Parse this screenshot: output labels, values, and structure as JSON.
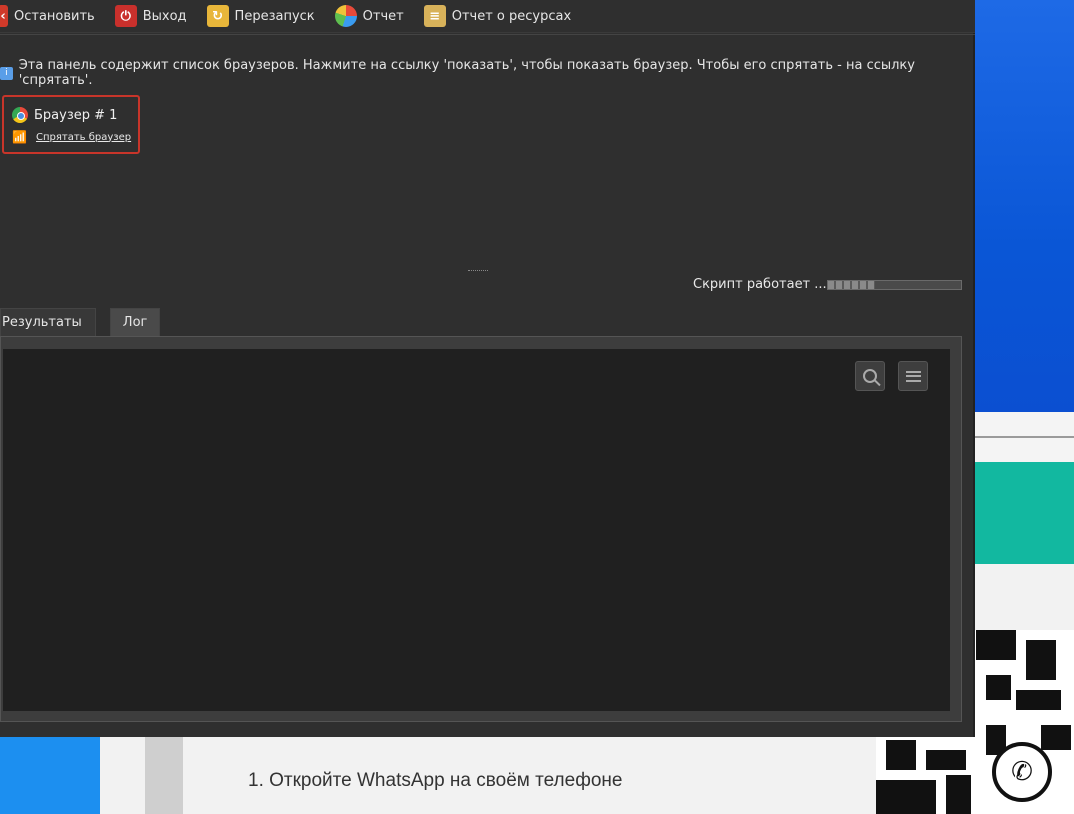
{
  "toolbar": {
    "stop_label": "Остановить",
    "exit_label": "Выход",
    "restart_label": "Перезапуск",
    "report_label": "Отчет",
    "resources_label": "Отчет о ресурсах"
  },
  "info": {
    "text": "Эта панель содержит список браузеров. Нажмите на ссылку 'показать', чтобы показать браузер. Чтобы его спрятать - на ссылку 'спрятать'."
  },
  "browsers": [
    {
      "name": "Браузер # 1",
      "action": "Спрятать браузер"
    }
  ],
  "status": {
    "text": "Скрипт работает ...",
    "progress": 0.35
  },
  "tabs": [
    {
      "label": "Результаты",
      "active": false
    },
    {
      "label": "Лог",
      "active": true
    }
  ],
  "background": {
    "instruction": "1. Откройте WhatsApp на своём телефоне"
  }
}
